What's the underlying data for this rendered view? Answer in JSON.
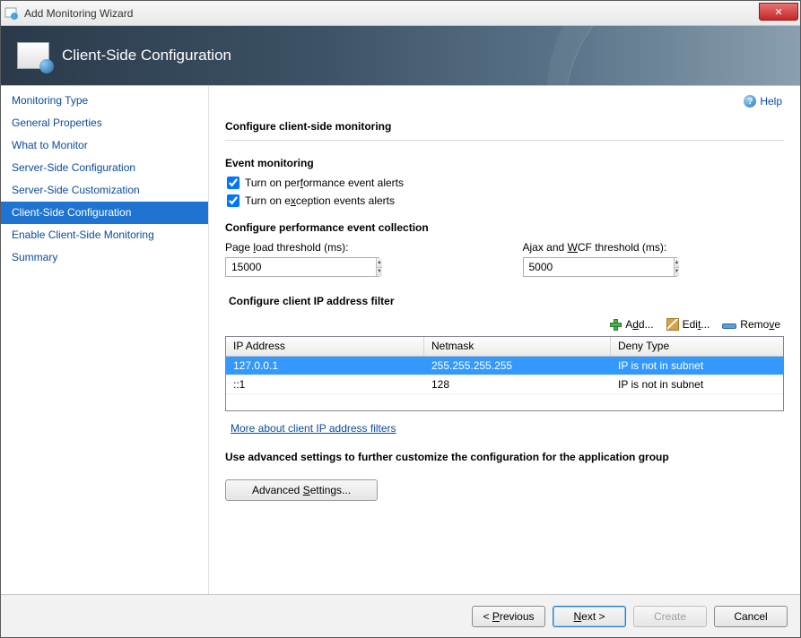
{
  "window": {
    "title": "Add Monitoring Wizard",
    "close_label": "✕"
  },
  "banner": {
    "title": "Client-Side Configuration"
  },
  "help": {
    "label": "Help"
  },
  "sidebar": {
    "items": [
      {
        "label": "Monitoring Type"
      },
      {
        "label": "General Properties"
      },
      {
        "label": "What to Monitor"
      },
      {
        "label": "Server-Side Configuration"
      },
      {
        "label": "Server-Side Customization"
      },
      {
        "label": "Client-Side Configuration"
      },
      {
        "label": "Enable Client-Side Monitoring"
      },
      {
        "label": "Summary"
      }
    ],
    "active_index": 5
  },
  "content": {
    "heading": "Configure client-side monitoring",
    "event_monitoring": {
      "title": "Event monitoring",
      "perf_alerts_label_pre": "Turn on per",
      "perf_alerts_label_u": "f",
      "perf_alerts_label_post": "ormance event alerts",
      "perf_alerts_checked": true,
      "exc_alerts_label_pre": "Turn on e",
      "exc_alerts_label_u": "x",
      "exc_alerts_label_post": "ception events alerts",
      "exc_alerts_checked": true
    },
    "perf_collection": {
      "title": "Configure performance event collection",
      "page_load_label_pre": "Page ",
      "page_load_label_u": "l",
      "page_load_label_post": "oad threshold (ms):",
      "page_load_value": "15000",
      "ajax_label_pre": "Ajax and ",
      "ajax_label_u": "W",
      "ajax_label_post": "CF threshold (ms):",
      "ajax_value": "5000"
    },
    "ip_filter": {
      "title": "Configure client IP address filter",
      "add_label_pre": "A",
      "add_label_u": "d",
      "add_label_post": "d...",
      "edit_label_pre": "Edi",
      "edit_label_u": "t",
      "edit_label_post": "...",
      "remove_label_pre": "Remo",
      "remove_label_u": "v",
      "remove_label_post": "e",
      "columns": {
        "ip": "IP Address",
        "mask": "Netmask",
        "deny": "Deny Type"
      },
      "rows": [
        {
          "ip": "127.0.0.1",
          "mask": "255.255.255.255",
          "deny": "IP is not in subnet",
          "selected": true
        },
        {
          "ip": "::1",
          "mask": "128",
          "deny": "IP is not in subnet",
          "selected": false
        }
      ],
      "more_link": "More about client IP address filters"
    },
    "advanced": {
      "text": "Use advanced settings to further customize the configuration for the application group",
      "button_pre": "Advanced ",
      "button_u": "S",
      "button_post": "ettings..."
    }
  },
  "footer": {
    "previous_pre": "< ",
    "previous_u": "P",
    "previous_post": "revious",
    "next_pre": "",
    "next_u": "N",
    "next_post": "ext >",
    "create": "Create",
    "cancel": "Cancel"
  }
}
